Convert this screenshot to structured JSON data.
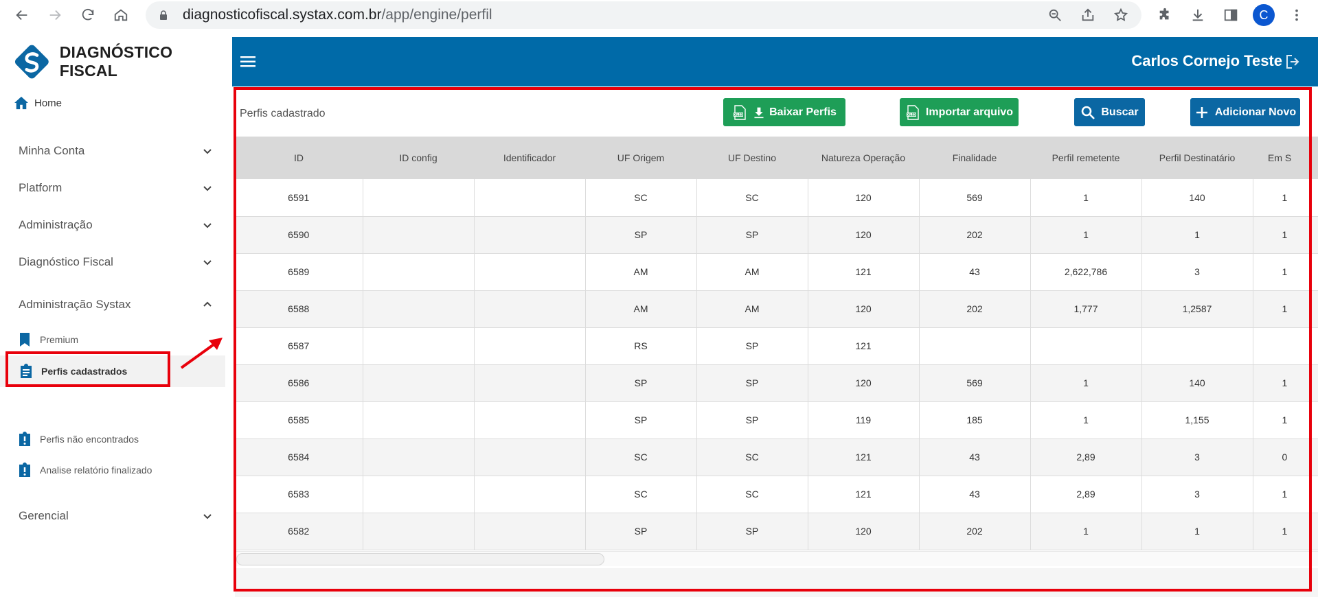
{
  "browser": {
    "url_host": "diagnosticofiscal.systax.com.br",
    "url_path": "/app/engine/perfil",
    "profile_initial": "C"
  },
  "brand": {
    "name": "DIAGNÓSTICO FISCAL"
  },
  "sidebar": {
    "home": "Home",
    "groups": [
      {
        "label": "Minha Conta"
      },
      {
        "label": "Platform"
      },
      {
        "label": "Administração"
      },
      {
        "label": "Diagnóstico Fiscal"
      },
      {
        "label": "Administração Systax"
      },
      {
        "label": "Gerencial"
      }
    ],
    "sub_items": [
      {
        "label": "Premium"
      },
      {
        "label": "Perfis cadastrados"
      },
      {
        "label": "Perfis não encontrados"
      },
      {
        "label": "Analise relatório finalizado"
      }
    ]
  },
  "header": {
    "user_name": "Carlos Cornejo Teste"
  },
  "main": {
    "title": "Perfis cadastrado",
    "buttons": {
      "download": "Baixar Perfis",
      "import": "Importar arquivo",
      "search": "Buscar",
      "add": "Adicionar Novo"
    }
  },
  "table": {
    "columns": [
      "ID",
      "ID config",
      "Identificador",
      "UF Origem",
      "UF Destino",
      "Natureza Operação",
      "Finalidade",
      "Perfil remetente",
      "Perfil Destinatário",
      "Em S"
    ],
    "rows": [
      [
        "6591",
        "",
        "",
        "SC",
        "SC",
        "120",
        "569",
        "1",
        "140",
        "1"
      ],
      [
        "6590",
        "",
        "",
        "SP",
        "SP",
        "120",
        "202",
        "1",
        "1",
        "1"
      ],
      [
        "6589",
        "",
        "",
        "AM",
        "AM",
        "121",
        "43",
        "2,622,786",
        "3",
        "1"
      ],
      [
        "6588",
        "",
        "",
        "AM",
        "AM",
        "120",
        "202",
        "1,777",
        "1,2587",
        "1"
      ],
      [
        "6587",
        "",
        "",
        "RS",
        "SP",
        "121",
        "",
        "",
        "",
        ""
      ],
      [
        "6586",
        "",
        "",
        "SP",
        "SP",
        "120",
        "569",
        "1",
        "140",
        "1"
      ],
      [
        "6585",
        "",
        "",
        "SP",
        "SP",
        "119",
        "185",
        "1",
        "1,155",
        "1"
      ],
      [
        "6584",
        "",
        "",
        "SC",
        "SC",
        "121",
        "43",
        "2,89",
        "3",
        "0"
      ],
      [
        "6583",
        "",
        "",
        "SC",
        "SC",
        "121",
        "43",
        "2,89",
        "3",
        "1"
      ],
      [
        "6582",
        "",
        "",
        "SP",
        "SP",
        "120",
        "202",
        "1",
        "1",
        "1"
      ]
    ]
  },
  "colors": {
    "header_blue": "#006aa8",
    "btn_green": "#1e9e57",
    "btn_blue": "#0b67a3",
    "annotation_red": "#e8000b"
  }
}
